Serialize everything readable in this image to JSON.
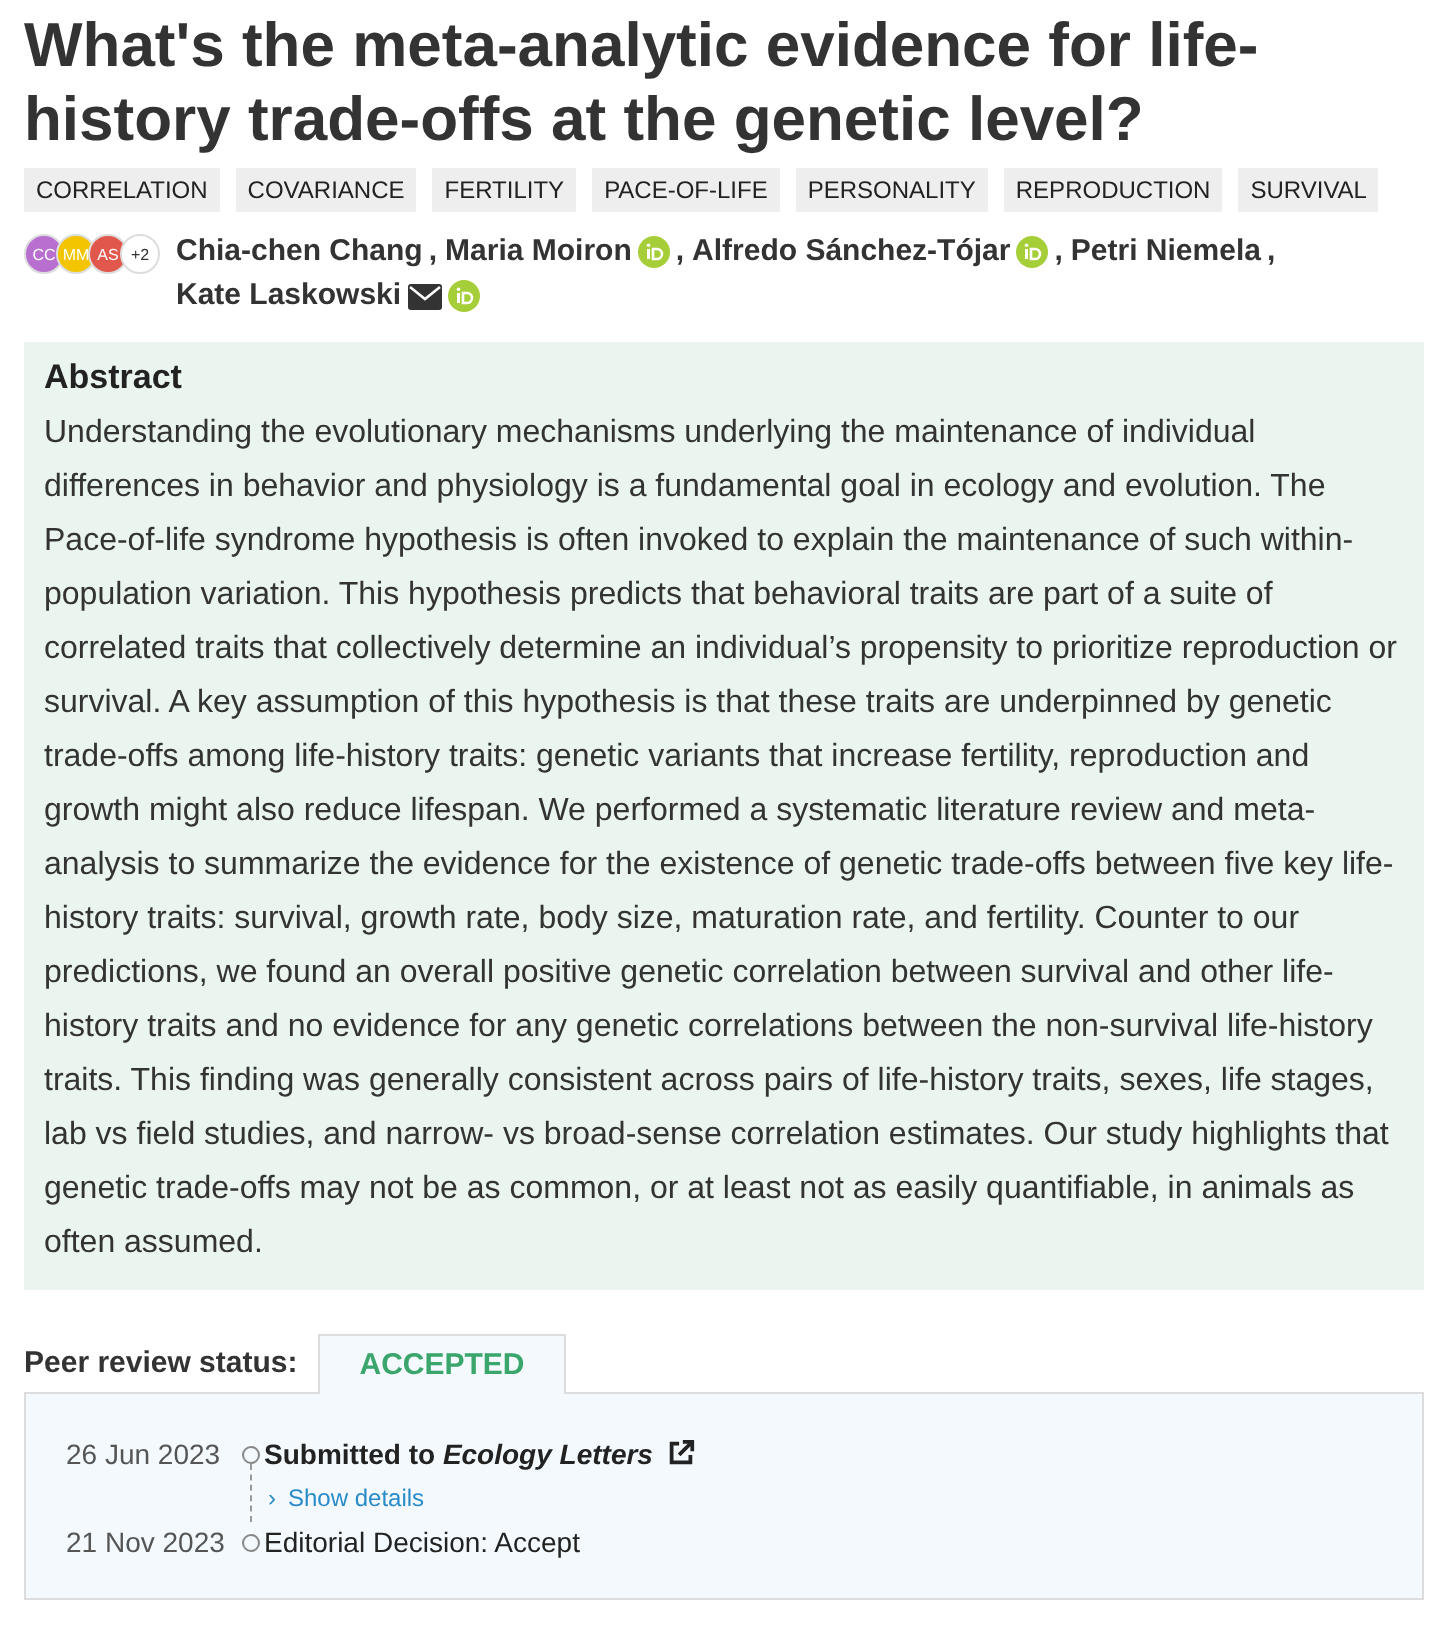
{
  "title": "What's the meta-analytic evidence for life-history trade-offs at the genetic level?",
  "keywords": [
    "CORRELATION",
    "COVARIANCE",
    "FERTILITY",
    "PACE-OF-LIFE",
    "PERSONALITY",
    "REPRODUCTION",
    "SURVIVAL"
  ],
  "avatars": [
    {
      "initials": "CC",
      "color": "#b86fd0"
    },
    {
      "initials": "MM",
      "color": "#f2c500"
    },
    {
      "initials": "AS",
      "color": "#e2574c"
    },
    {
      "initials": "+2",
      "color": "#ffffff"
    }
  ],
  "authors": [
    {
      "name": "Chia-chen Chang",
      "orcid": false,
      "email": false,
      "separator": ","
    },
    {
      "name": "Maria Moiron",
      "orcid": true,
      "email": false,
      "separator": ","
    },
    {
      "name": "Alfredo Sánchez-Tójar",
      "orcid": true,
      "email": false,
      "separator": ","
    },
    {
      "name": "Petri Niemela",
      "orcid": false,
      "email": false,
      "separator": ","
    },
    {
      "name": "Kate Laskowski",
      "orcid": true,
      "email": true
    }
  ],
  "abstract": {
    "heading": "Abstract",
    "text": "Understanding the evolutionary mechanisms underlying the maintenance of individual differences in behavior and physiology is a fundamental goal in ecology and evolution. The Pace-of-life syndrome hypothesis is often invoked to explain the maintenance of such within-population variation. This hypothesis predicts that behavioral traits are part of a suite of correlated traits that collectively determine an individual’s propensity to prioritize reproduction or survival. A key assumption of this hypothesis is that these traits are underpinned by genetic trade-offs among life-history traits: genetic variants that increase fertility, reproduction and growth might also reduce lifespan. We performed a systematic literature review and meta-analysis to summarize the evidence for the existence of genetic trade-offs between five key life-history traits: survival, growth rate, body size, maturation rate, and fertility. Counter to our predictions, we found an overall positive genetic correlation between survival and other life-history traits and no evidence for any genetic correlations between the non-survival life-history traits. This finding was generally consistent across pairs of life-history traits, sexes, life stages, lab vs field studies, and narrow- vs broad-sense correlation estimates. Our study highlights that genetic trade-offs may not be as common, or at least not as easily quantifiable, in animals as often assumed."
  },
  "peer_review": {
    "label": "Peer review status:",
    "status": "ACCEPTED",
    "events": [
      {
        "date": "26 Jun 2023",
        "text": "Submitted to *Ecology Letters*",
        "bold": true,
        "external_link": true,
        "details_icon": "›",
        "details": "Show details"
      },
      {
        "date": "21 Nov 2023",
        "text": "Editorial Decision: Accept",
        "bold": false,
        "external_link": false
      }
    ]
  }
}
